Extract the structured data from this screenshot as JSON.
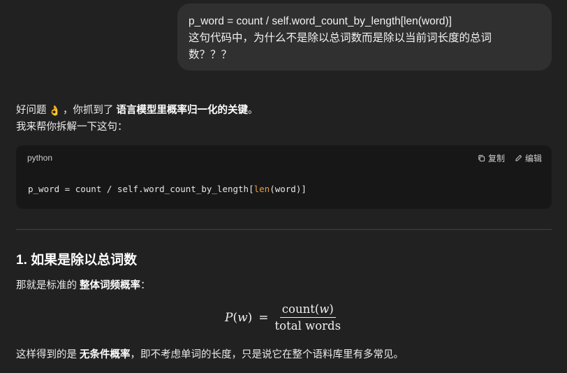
{
  "user_message": {
    "line1": "p_word = count / self.word_count_by_length[len(word)]",
    "line2": "这句代码中，为什么不是除以总词数而是除以当前词长度的总词",
    "line3": "数？？？"
  },
  "answer": {
    "intro_prefix": "好问题",
    "intro_emoji": "👌",
    "intro_mid": "，你抓到了",
    "intro_bold": "语言模型里概率归一化的关键",
    "intro_suffix": "。",
    "intro_line2": "我来帮你拆解一下这句："
  },
  "code_block": {
    "language": "python",
    "copy_label": "复制",
    "edit_label": "编辑",
    "code_part1": "p_word = count / self.word_count_by_length[",
    "code_len": "len",
    "code_part2": "(word)]",
    "copy_icon": "copy-icon",
    "edit_icon": "pencil-icon"
  },
  "section1": {
    "heading": "1. 如果是除以总词数",
    "line_prefix": "那就是标准的",
    "line_bold": "整体词频概率",
    "line_suffix": "：",
    "formula": {
      "lhs_p": "P",
      "lhs_w": "w",
      "numerator_text": "count",
      "numerator_var": "w",
      "denominator": "total words"
    },
    "conclusion_prefix": "这样得到的是",
    "conclusion_bold": "无条件概率",
    "conclusion_suffix": "，即不考虑单词的长度，只是说它在整个语料库里有多常见。"
  },
  "colors": {
    "background": "#212121",
    "bubble": "#303030",
    "code_bg": "#171717",
    "keyword": "#e5a13a"
  }
}
